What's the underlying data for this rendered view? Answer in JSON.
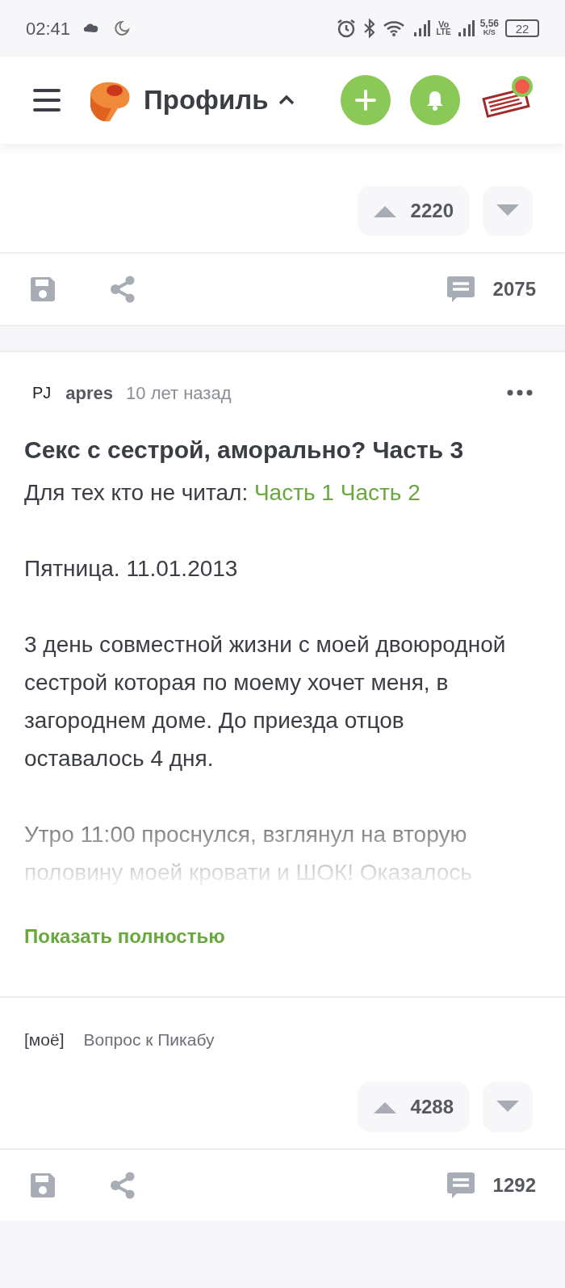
{
  "status_bar": {
    "time": "02:41",
    "volte_top": "Vo",
    "volte_bottom": "LTE",
    "speed": "5,56",
    "speed_unit": "K/S",
    "battery": "22"
  },
  "header": {
    "title": "Профиль",
    "expanded": true,
    "notification": true
  },
  "posts": [
    {
      "rating": "2220",
      "comments": "2075"
    },
    {
      "avatar": "PJ",
      "author": "apres",
      "time": "10 лет назад",
      "title": "Секс с сестрой, аморально? Часть 3",
      "intro": "Для тех кто не читал:",
      "links": [
        "Часть 1",
        "Часть 2"
      ],
      "paragraphs": [
        "Пятница. 11.01.2013",
        "3 день совместной жизни с моей двоюродной сестрой которая по моему хочет меня, в загороднем доме. До приезда отцов оставалось 4 дня.",
        "Утро 11:00 проснулся, взглянул на вторую половину моей кровати и ШОК! Оказалось"
      ],
      "show_more": "Показать полностью",
      "tags": [
        "[моё]",
        "Вопрос к Пикабу"
      ],
      "rating": "4288",
      "comments": "1292"
    }
  ]
}
